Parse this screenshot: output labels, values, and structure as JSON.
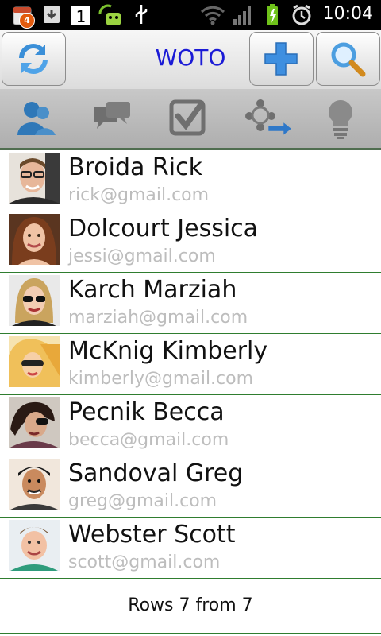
{
  "status_bar": {
    "notification_count": "4",
    "sim_slot": "1",
    "time": "10:04",
    "icons": [
      "calendar-notification-icon",
      "download-icon",
      "sim-icon",
      "android-robot-icon",
      "usb-icon",
      "wifi-icon",
      "signal-icon",
      "battery-charging-icon",
      "alarm-icon"
    ]
  },
  "header": {
    "title": "WOTO",
    "title_color": "#1b1bd6",
    "buttons": [
      "refresh-icon",
      "add-icon",
      "search-icon"
    ]
  },
  "tabs": [
    {
      "name": "tab-contacts",
      "icon": "contacts-icon"
    },
    {
      "name": "tab-messages",
      "icon": "chat-bubbles-icon"
    },
    {
      "name": "tab-tasks",
      "icon": "checkbox-icon"
    },
    {
      "name": "tab-groups",
      "icon": "group-arrow-icon"
    },
    {
      "name": "tab-ideas",
      "icon": "lightbulb-icon"
    }
  ],
  "contacts": [
    {
      "name": "Broida Rick",
      "email": "rick@gmail.com"
    },
    {
      "name": "Dolcourt Jessica",
      "email": "jessi@gmail.com"
    },
    {
      "name": "Karch Marziah",
      "email": "marziah@gmail.com"
    },
    {
      "name": "McKnig Kimberly",
      "email": "kimberly@gmail.com"
    },
    {
      "name": "Pecnik Becca",
      "email": "becca@gmail.com"
    },
    {
      "name": "Sandoval Greg",
      "email": "greg@gmail.com"
    },
    {
      "name": "Webster Scott",
      "email": "scott@gmail.com"
    }
  ],
  "footer": {
    "rows_text": "Rows 7 from 7"
  },
  "colors": {
    "accent": "#1b1bd6",
    "divider": "#2f7d2f",
    "email_text": "#bdbdbd"
  }
}
